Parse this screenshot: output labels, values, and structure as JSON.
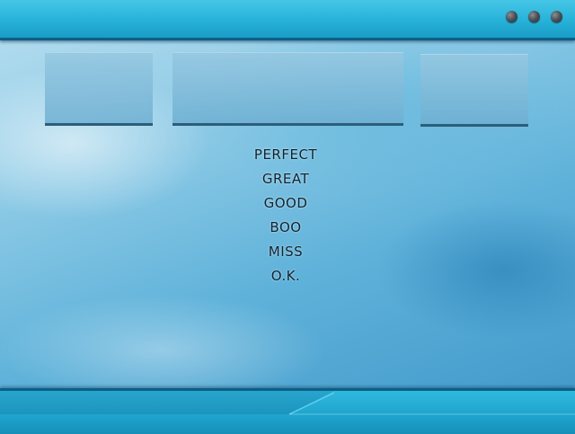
{
  "judgments": [
    "PERFECT",
    "GREAT",
    "GOOD",
    "BOO",
    "MISS",
    "O.K."
  ],
  "colors": {
    "bar_light": "#45c6e6",
    "bar_dark": "#1a9cc5",
    "bar_border": "#0c5f86",
    "text": "#0f2330"
  }
}
